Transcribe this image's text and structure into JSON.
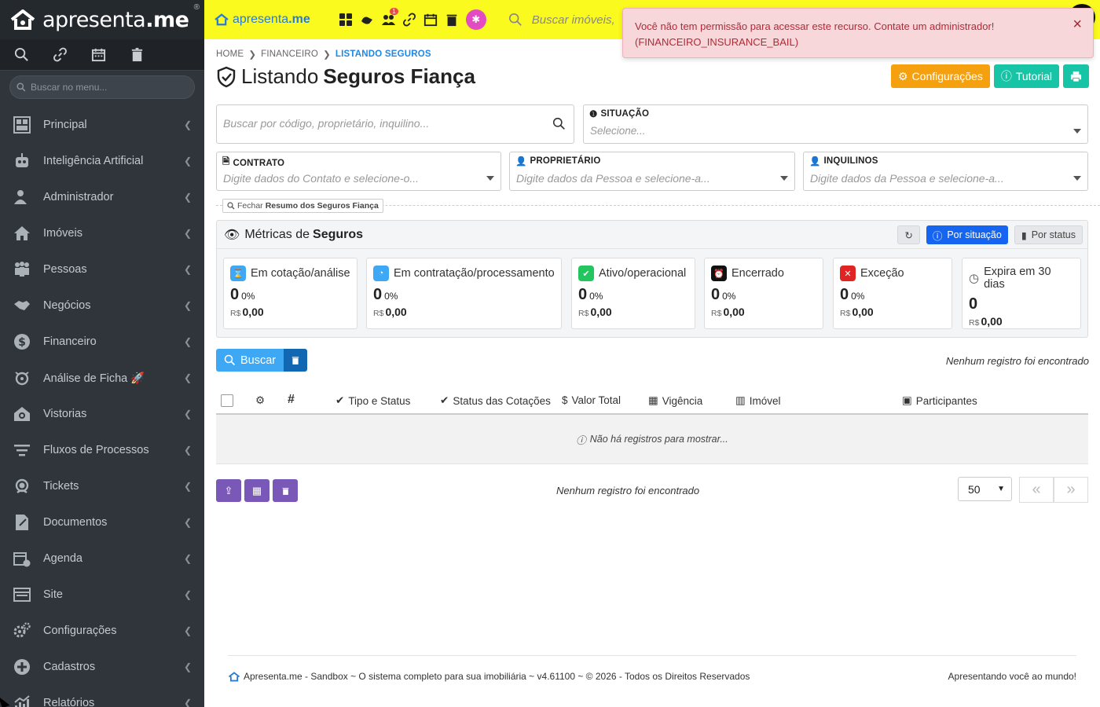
{
  "brand": {
    "prefix": "apresenta",
    "suffix": ".me",
    "reg": "®"
  },
  "sidebar": {
    "search_placeholder": "Buscar no menu...",
    "quick_icons": [
      "search-icon",
      "link-icon",
      "calendar-icon",
      "trash-icon"
    ],
    "items": [
      {
        "label": "Principal",
        "icon": "dashboard-icon"
      },
      {
        "label": "Inteligência Artificial",
        "icon": "robot-icon"
      },
      {
        "label": "Administrador",
        "icon": "user-shield-icon"
      },
      {
        "label": "Imóveis",
        "icon": "home-icon"
      },
      {
        "label": "Pessoas",
        "icon": "people-icon"
      },
      {
        "label": "Negócios",
        "icon": "handshake-icon"
      },
      {
        "label": "Financeiro",
        "icon": "dollar-icon"
      },
      {
        "label": "Análise de Ficha 🚀",
        "icon": "analysis-icon"
      },
      {
        "label": "Vistorias",
        "icon": "inspection-icon"
      },
      {
        "label": "Fluxos de Processos",
        "icon": "flow-icon"
      },
      {
        "label": "Tickets",
        "icon": "support-icon"
      },
      {
        "label": "Documentos",
        "icon": "document-icon"
      },
      {
        "label": "Agenda",
        "icon": "agenda-icon"
      },
      {
        "label": "Site",
        "icon": "site-icon"
      },
      {
        "label": "Configurações",
        "icon": "cogs-icon"
      },
      {
        "label": "Cadastros",
        "icon": "plus-circle-icon"
      },
      {
        "label": "Relatórios",
        "icon": "chart-icon"
      }
    ]
  },
  "topbar": {
    "logo_prefix": "apresenta",
    "logo_suffix": ".me",
    "badge": "1",
    "search_placeholder": "Buscar imóveis,"
  },
  "alert": {
    "line1": "Você não tem permissão para acessar este recurso. Contate um administrador!",
    "line2": "(FINANCEIRO_INSURANCE_BAIL)",
    "close": "×"
  },
  "breadcrumb": [
    "HOME",
    "FINANCEIRO",
    "LISTANDO SEGUROS"
  ],
  "title": {
    "prefix": "Listando",
    "bold": "Seguros Fiança"
  },
  "buttons": {
    "config": "Configurações",
    "tutorial": "Tutorial"
  },
  "filters": {
    "search_placeholder": "Buscar por código, proprietário, inquilino...",
    "situacao_label": "SITUAÇÃO",
    "situacao_placeholder": "Selecione...",
    "contrato_label": "CONTRATO",
    "contrato_placeholder": "Digite dados do Contato e selecione-o...",
    "proprietario_label": "PROPRIETÁRIO",
    "proprietario_placeholder": "Digite dados da Pessoa e selecione-a...",
    "inquilinos_label": "INQUILINOS",
    "inquilinos_placeholder": "Digite dados da Pessoa e selecione-a..."
  },
  "toggle_summary": {
    "prefix": "Fechar",
    "bold": "Resumo dos Seguros Fiança"
  },
  "metrics": {
    "title_prefix": "Métricas de",
    "title_bold": "Seguros",
    "by_situation": "Por situação",
    "by_status": "Por status",
    "cards": [
      {
        "title": "Em cotação/análise",
        "count": "0",
        "pct": "0%",
        "currency": "R$",
        "value": "0,00",
        "color": "#3ea8f5"
      },
      {
        "title": "Em contratação/processamento",
        "count": "0",
        "pct": "0%",
        "currency": "R$",
        "value": "0,00",
        "color": "#3ea8f5"
      },
      {
        "title": "Ativo/operacional",
        "count": "0",
        "pct": "0%",
        "currency": "R$",
        "value": "0,00",
        "color": "#22c55e"
      },
      {
        "title": "Encerrado",
        "count": "0",
        "pct": "0%",
        "currency": "R$",
        "value": "0,00",
        "color": "#111111"
      },
      {
        "title": "Exceção",
        "count": "0",
        "pct": "0%",
        "currency": "R$",
        "value": "0,00",
        "color": "#e02424"
      },
      {
        "title": "Expira em 30 dias",
        "count": "0",
        "pct": "",
        "currency": "R$",
        "value": "0,00",
        "color": "#555555"
      }
    ]
  },
  "actions": {
    "search": "Buscar"
  },
  "results": {
    "none_found": "Nenhum registro foi encontrado",
    "empty_table": "Não há registros para mostrar..."
  },
  "table_headers": {
    "hash": "#",
    "tipo_status": "Tipo e Status",
    "status_cotacoes": "Status das Cotações",
    "valor_total": "Valor Total",
    "vigencia": "Vigência",
    "imovel": "Imóvel",
    "participantes": "Participantes"
  },
  "pagination": {
    "per_page": "50"
  },
  "footer": {
    "left": "Apresenta.me - Sandbox ~ O sistema completo para sua imobiliária ~ v4.61100 ~ © 2026 - Todos os Direitos Reservados",
    "right": "Apresentando você ao mundo!"
  }
}
